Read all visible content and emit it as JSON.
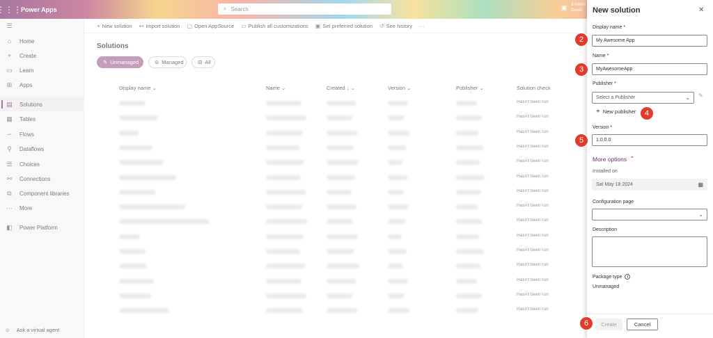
{
  "header": {
    "brand": "Power Apps",
    "search_placeholder": "Search",
    "env_line1": "Environ",
    "env_line2": "Devel"
  },
  "nav": [
    {
      "label": "Home",
      "icon": "⌂"
    },
    {
      "label": "Create",
      "icon": "+"
    },
    {
      "label": "Learn",
      "icon": "▭"
    },
    {
      "label": "Apps",
      "icon": "⊞"
    },
    {
      "label": "Solutions",
      "icon": "▤",
      "active": true
    },
    {
      "label": "Tables",
      "icon": "▦"
    },
    {
      "label": "Flows",
      "icon": "∽"
    },
    {
      "label": "Dataflows",
      "icon": "⚲"
    },
    {
      "label": "Choices",
      "icon": "☰"
    },
    {
      "label": "Connections",
      "icon": "⚯"
    },
    {
      "label": "Component libraries",
      "icon": "⧉"
    },
    {
      "label": "More",
      "icon": "···"
    },
    {
      "label": "Power Platform",
      "icon": "◧"
    }
  ],
  "agent": "Ask a virtual agent",
  "commands": [
    {
      "label": "New solution",
      "icon": "+"
    },
    {
      "label": "Import solution",
      "icon": "↤"
    },
    {
      "label": "Open AppSource",
      "icon": "▢"
    },
    {
      "label": "Publish all customizations",
      "icon": "▭"
    },
    {
      "label": "Set preferred solution",
      "icon": "▣"
    },
    {
      "label": "See history",
      "icon": "↺"
    },
    {
      "label": "···",
      "icon": ""
    }
  ],
  "page_title": "Solutions",
  "filters": {
    "unmanaged": "Unmanaged",
    "managed": "Managed",
    "all": "All"
  },
  "table": {
    "headers": {
      "display_name": "Display name",
      "name": "Name",
      "created": "Created",
      "version": "Version",
      "publisher": "Publisher",
      "check": "Solution check"
    },
    "check_value": "Hasn't been run",
    "rows": 15
  },
  "panel": {
    "title": "New solution",
    "display_name_label": "Display name *",
    "display_name_value": "My Awesome App",
    "name_label": "Name *",
    "name_value": "MyAwesomeApp",
    "publisher_label": "Publisher *",
    "publisher_placeholder": "Select a Publisher",
    "new_publisher": "New publisher",
    "version_label": "Version *",
    "version_value": "1.0.0.0",
    "more_options": "More options",
    "installed_on_label": "Installed on",
    "installed_on_value": "Sat May 18 2024",
    "config_label": "Configuration page",
    "description_label": "Description",
    "package_type_label": "Package type",
    "package_type_value": "Unmanaged",
    "create": "Create",
    "cancel": "Cancel"
  },
  "badges": [
    "2",
    "3",
    "4",
    "5",
    "6"
  ]
}
